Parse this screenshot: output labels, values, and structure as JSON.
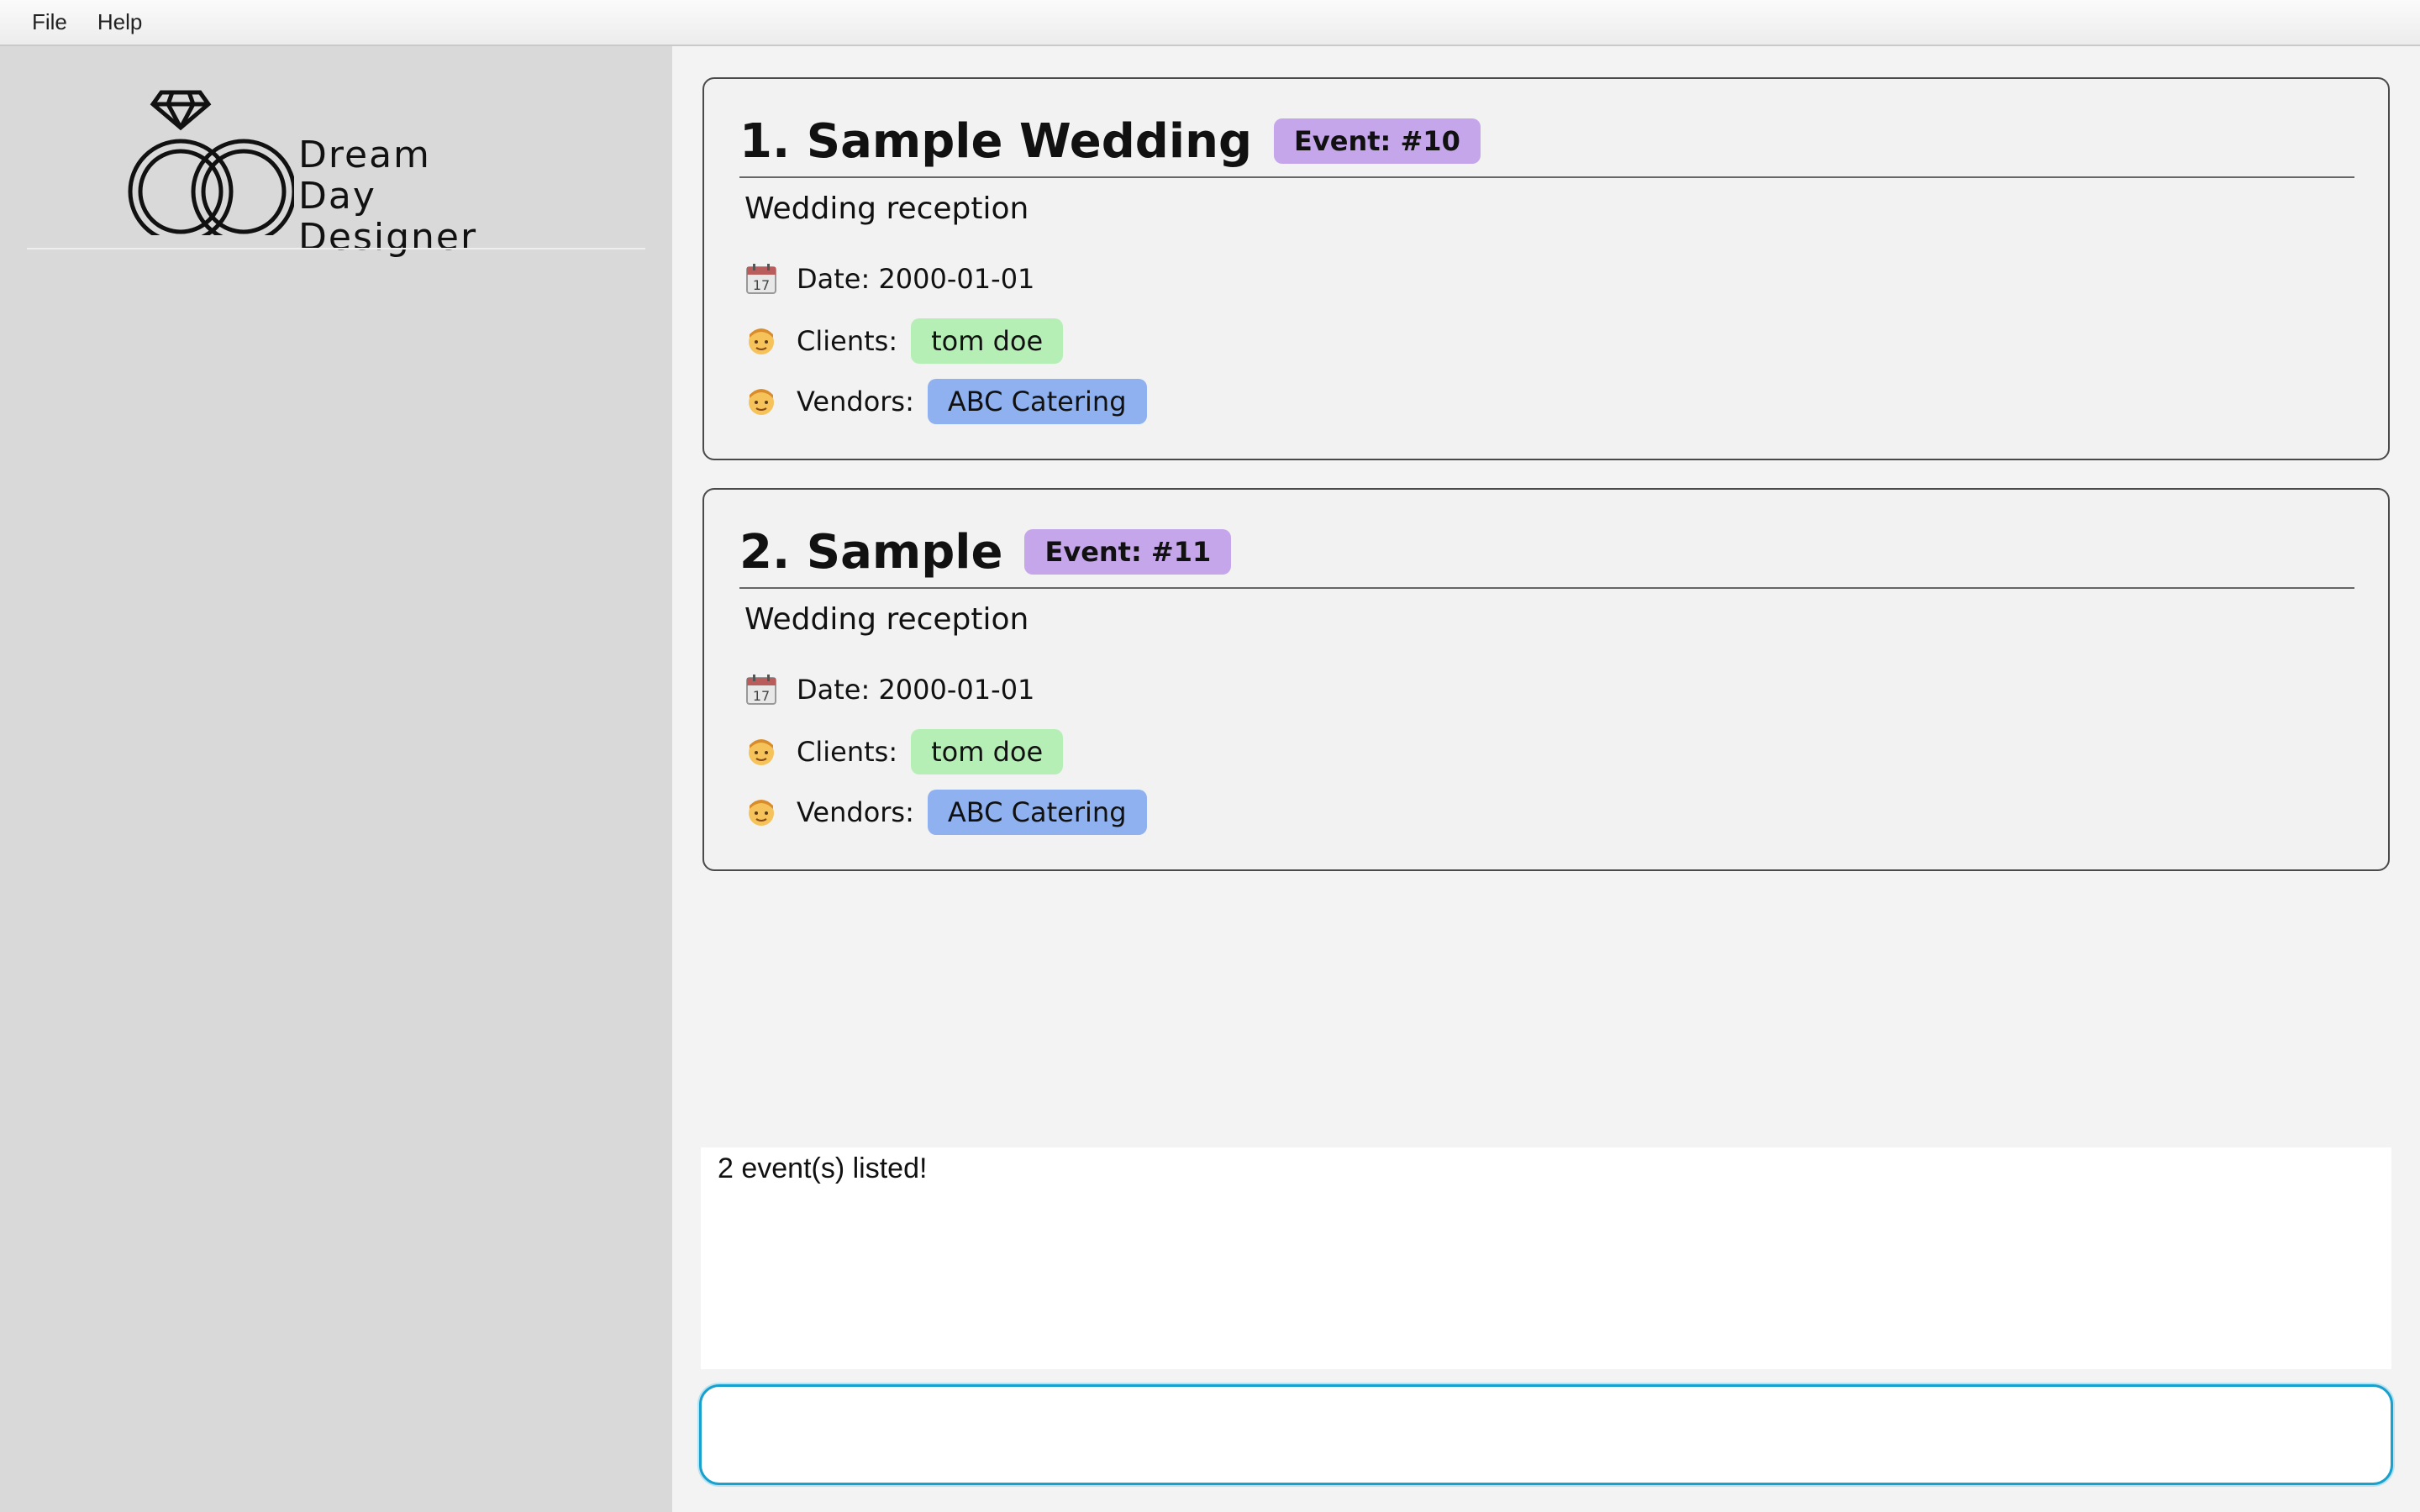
{
  "menu": {
    "file": "File",
    "help": "Help"
  },
  "logo": {
    "line1": "Dream",
    "line2": "Day",
    "line3": "Designer"
  },
  "icons": {
    "date": "calendar-icon",
    "person": "person-icon",
    "logo": "wedding-rings-icon"
  },
  "colors": {
    "event_badge": "#c6a6ea",
    "client_tag": "#b6efb6",
    "vendor_tag": "#8fb1f0",
    "command_border": "#1aa0cc"
  },
  "events": [
    {
      "title": "1. Sample Wedding",
      "badge": "Event: #10",
      "description": "Wedding reception",
      "date": "Date: 2000-01-01",
      "clients_label": "Clients:",
      "client": "tom doe",
      "vendors_label": "Vendors:",
      "vendor": "ABC Catering"
    },
    {
      "title": "2. Sample",
      "badge": "Event: #11",
      "description": "Wedding reception",
      "date": "Date: 2000-01-01",
      "clients_label": "Clients:",
      "client": "tom doe",
      "vendors_label": "Vendors:",
      "vendor": "ABC Catering"
    }
  ],
  "result": {
    "text": "2 event(s) listed!"
  },
  "command": {
    "value": ""
  }
}
